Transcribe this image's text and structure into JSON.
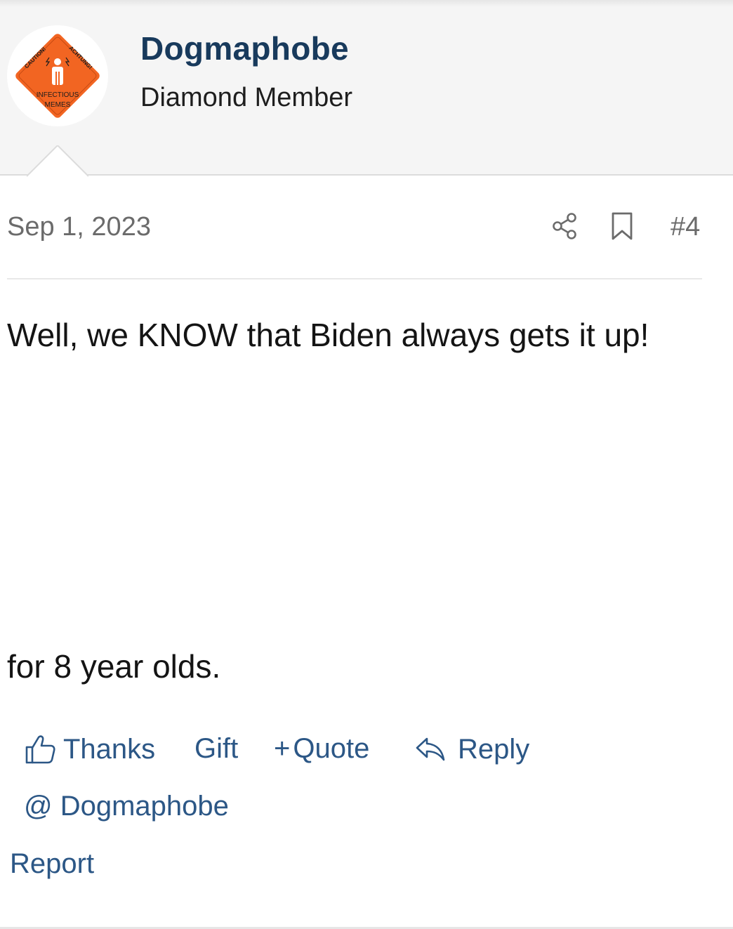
{
  "user": {
    "name": "Dogmaphobe",
    "title": "Diamond Member",
    "avatar": {
      "top_left_text": "CAUTION!",
      "top_right_text": "ACHTUNG!",
      "bottom_text_line1": "INFECTIOUS",
      "bottom_text_line2": "MEMES",
      "sign_color": "#f26522"
    }
  },
  "post": {
    "date": "Sep 1, 2023",
    "number": "#4",
    "lines": [
      "Well, we KNOW that Biden always gets it up!",
      "for 8 year olds."
    ]
  },
  "actions": {
    "thanks": "Thanks",
    "gift": "Gift",
    "quote_prefix": "+",
    "quote": "Quote",
    "reply": "Reply",
    "mention": "@ Dogmaphobe",
    "report": "Report"
  },
  "icons": {
    "share": "share-icon",
    "bookmark": "bookmark-icon",
    "thumbs_up": "thumbs-up-icon",
    "reply": "reply-arrow-icon"
  },
  "colors": {
    "username": "#183a5c",
    "link": "#2c5786",
    "muted": "#6b6b6b",
    "header_bg": "#f5f5f5"
  }
}
